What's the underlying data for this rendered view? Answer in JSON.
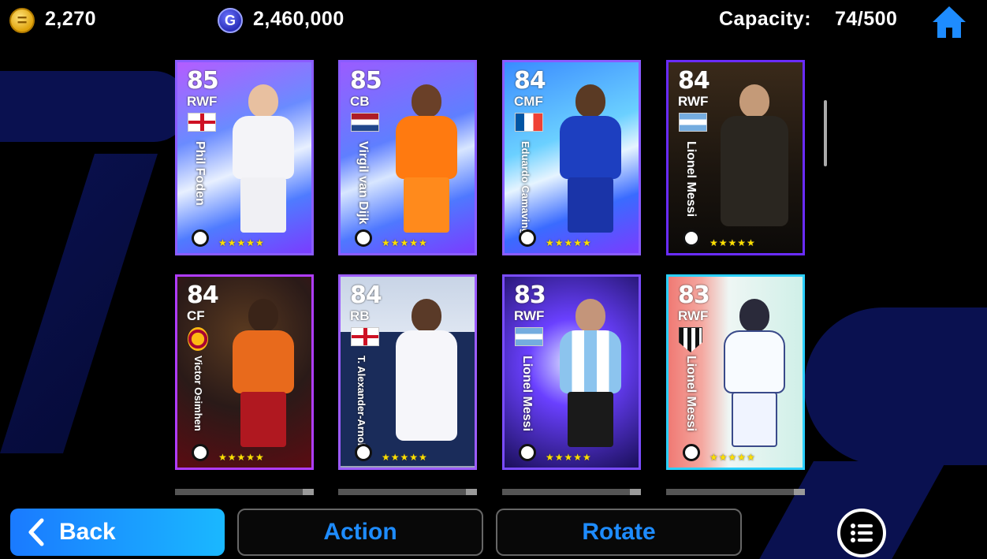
{
  "header": {
    "coins": "2,270",
    "gp": "2,460,000",
    "capacity_label": "Capacity:",
    "capacity_value": "74/500",
    "gp_icon_letter": "G"
  },
  "cards": [
    {
      "rating": "85",
      "position": "RWF",
      "name": "Phil Foden",
      "flag": "england",
      "stars": "★★★★★"
    },
    {
      "rating": "85",
      "position": "CB",
      "name": "Virgil van Dijk",
      "flag": "netherlands",
      "stars": "★★★★★"
    },
    {
      "rating": "84",
      "position": "CMF",
      "name": "Eduardo Camavinga",
      "flag": "france",
      "stars": "★★★★★"
    },
    {
      "rating": "84",
      "position": "RWF",
      "name": "Lionel Messi",
      "flag": "argentina",
      "stars": "★★★★★"
    },
    {
      "rating": "84",
      "position": "CF",
      "name": "Victor Osimhen",
      "flag": "galatasaray",
      "stars": "★★★★★"
    },
    {
      "rating": "84",
      "position": "RB",
      "name": "T. Alexander-Arnold",
      "flag": "england",
      "stars": "★★★★★"
    },
    {
      "rating": "83",
      "position": "RWF",
      "name": "Lionel Messi",
      "flag": "argentina",
      "stars": "★★★★★"
    },
    {
      "rating": "83",
      "position": "RWF",
      "name": "Lionel Messi",
      "flag": "club-crest",
      "stars": "★★★★★"
    }
  ],
  "buttons": {
    "back": "Back",
    "action": "Action",
    "rotate": "Rotate"
  },
  "icons": {
    "coin": "coin-icon",
    "gp": "gp-icon",
    "home": "home-icon",
    "menu": "list-menu-icon",
    "back": "chevron-left-icon"
  },
  "colors": {
    "accent": "#1e8cff",
    "back_button": "#1a9aff",
    "home": "#1e8cff"
  }
}
